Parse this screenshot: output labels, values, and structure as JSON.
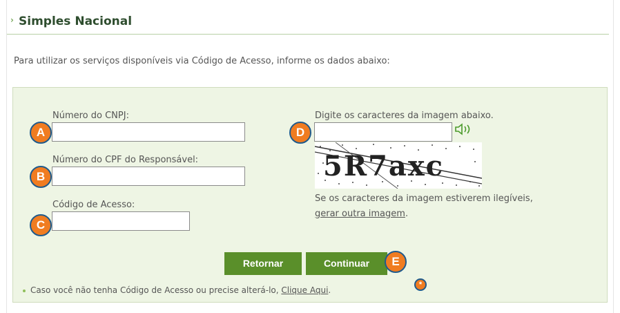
{
  "header": {
    "title": "Simples Nacional"
  },
  "intro": "Para utilizar os serviços disponíveis via Código de Acesso, informe os dados abaixo:",
  "form": {
    "cnpj_label": "Número do CNPJ:",
    "cnpj_value": "",
    "cpf_label": "Número do CPF do Responsável:",
    "cpf_value": "",
    "codigo_label": "Código de Acesso:",
    "codigo_value": "",
    "captcha_label": "Digite os caracteres da imagem abaixo.",
    "captcha_value": "",
    "captcha_text": "5R7axc",
    "captcha_hint_line1": "Se os caracteres da imagem estiverem ilegíveis,",
    "captcha_hint_link": "gerar outra imagem",
    "captcha_hint_end": "."
  },
  "buttons": {
    "retornar": "Retornar",
    "continuar": "Continuar"
  },
  "footer": {
    "text": "Caso você não tenha Código de Acesso ou precise alterá-lo, ",
    "link": "Clique Aqui",
    "end": "."
  },
  "markers": {
    "a": "A",
    "b": "B",
    "c": "C",
    "d": "D",
    "e": "E",
    "star": "*"
  },
  "icons": {
    "speaker": "speaker-icon",
    "chevron": "chevron-right-icon"
  },
  "colors": {
    "button": "#5a8f2a",
    "panel": "#eef5e4",
    "marker": "#f07c21",
    "marker_border": "#1f5a8c"
  }
}
